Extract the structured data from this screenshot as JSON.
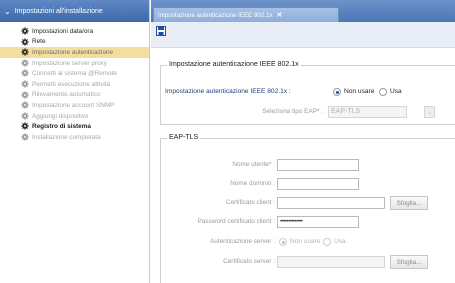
{
  "sidebar": {
    "header": "Impostazioni all'installazione",
    "items": [
      {
        "label": "Impostazioni data/ora",
        "state": "enabled"
      },
      {
        "label": "Rete",
        "state": "enabled"
      },
      {
        "label": "Impostazione autenticazione",
        "state": "selected"
      },
      {
        "label": "Impostazione server proxy",
        "state": "disabled"
      },
      {
        "label": "Connetti al sistema @Remote",
        "state": "disabled"
      },
      {
        "label": "Permetti esecuzione attività",
        "state": "disabled"
      },
      {
        "label": "Rilevamento automatico",
        "state": "disabled"
      },
      {
        "label": "Impostazione account SNMP",
        "state": "disabled"
      },
      {
        "label": "Aggiungi dispositivo",
        "state": "disabled"
      },
      {
        "label": "Registro di sistema",
        "state": "bold"
      },
      {
        "label": "Installazione completata",
        "state": "disabled"
      }
    ]
  },
  "tab": {
    "label": "Impostazione autenticazione IEEE 802.1x",
    "close": "✕"
  },
  "ieee": {
    "legend": "Impostazione autenticazione IEEE 802.1x",
    "toggle_label": "Impostazione autenticazione IEEE 802.1x :",
    "option_off": "Non usare",
    "option_on": "Usa",
    "selected": "Non usare",
    "eap_label": "Seleziona tipo EAP* :",
    "eap_value": "EAP-TLS"
  },
  "eaptls": {
    "legend": "EAP-TLS",
    "username_label": "Nome utente* :",
    "username_value": "",
    "domain_label": "Nome dominio :",
    "domain_value": "",
    "client_cert_label": "Certificato client :",
    "client_cert_value": "",
    "browse1": "Sfoglia...",
    "password_label": "Password certificato client :",
    "password_value": "••••••••••••••",
    "server_auth_label": "Autenticazione server :",
    "server_auth_off": "Non usare",
    "server_auth_on": "Usa",
    "server_cert_label": "Certificato server :",
    "server_cert_value": "",
    "browse2": "Sfoglia..."
  },
  "colors": {
    "header_blue": "#3e6aab",
    "selected_bg": "#f3dea0",
    "radio_dot": "#1d4fa0"
  }
}
